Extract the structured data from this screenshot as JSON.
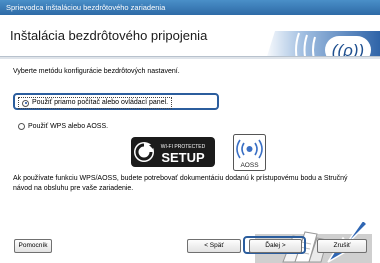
{
  "window": {
    "title": "Sprievodca inštaláciou bezdrôtového zariadenia"
  },
  "header": {
    "title": "Inštalácia bezdrôtového pripojenia"
  },
  "content": {
    "lead": "Vyberte metódu konfigurácie bezdrôtových nastavení.",
    "options": [
      {
        "label": "Použiť priamo počítač alebo ovládací panel.",
        "selected": true
      },
      {
        "label": "Použiť WPS alebo AOSS.",
        "selected": false
      }
    ],
    "logos": {
      "wps_top": "WI-FI PROTECTED",
      "wps_main": "SETUP",
      "aoss": "AOSS"
    },
    "info": "Ak používate funkciu WPS/AOSS, budete potrebovať dokumentáciu dodanú k prístupovému bodu a Stručný návod na obsluhu pre vaše zariadenie."
  },
  "footer": {
    "help_label": "Pomocník",
    "back_label": "< Späť",
    "next_label": "Ďalej >",
    "cancel_label": "Zrušiť"
  },
  "colors": {
    "titlebar": "#2d6aa6",
    "banner": "#3a6fae",
    "highlight_border": "#2b5d9d",
    "arrow": "#2f66b3"
  }
}
